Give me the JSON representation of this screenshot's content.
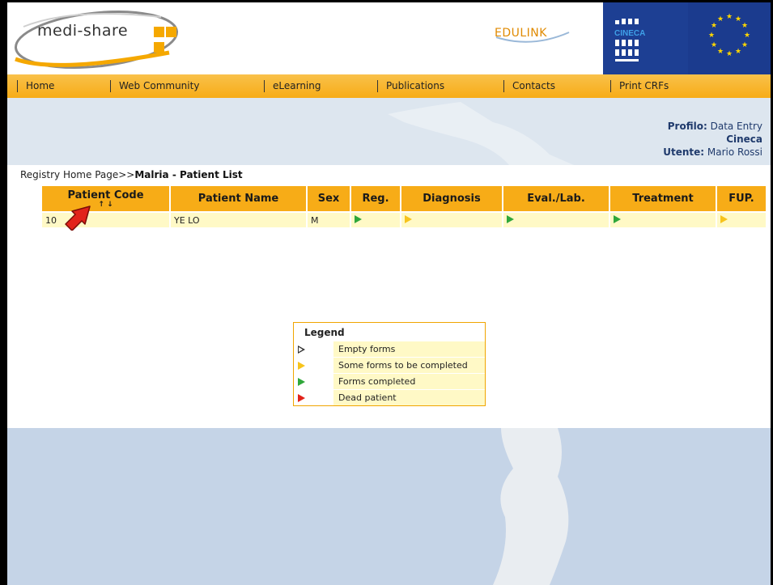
{
  "header": {
    "logo_text": "medi-share",
    "edulink_text": "EDULINK",
    "cineca_text": "CINECA"
  },
  "nav": {
    "items": [
      "Home",
      "Web Community",
      "eLearning",
      "Publications",
      "Contacts",
      "Print CRFs"
    ]
  },
  "profile": {
    "profilo_label": "Profilo:",
    "profilo_value": "Data Entry",
    "org": "Cineca",
    "utente_label": "Utente:",
    "utente_value": "Mario Rossi"
  },
  "breadcrumb": {
    "home": "Registry Home Page>>",
    "current": "Malria - Patient List"
  },
  "table": {
    "headers": [
      "Patient Code",
      "Patient Name",
      "Sex",
      "Reg.",
      "Diagnosis",
      "Eval./Lab.",
      "Treatment",
      "FUP."
    ],
    "sort_arrows": "↑ ↓",
    "rows": [
      {
        "code": "10",
        "name": "YE LO",
        "sex": "M",
        "reg": "green",
        "diagnosis": "yellow",
        "eval": "green",
        "treatment": "green",
        "fup": "yellow"
      }
    ]
  },
  "legend": {
    "title": "Legend",
    "items": [
      {
        "icon": "empty-triangle-icon",
        "label": "Empty forms"
      },
      {
        "icon": "yellow-triangle-icon",
        "label": "Some forms to be completed"
      },
      {
        "icon": "green-triangle-icon",
        "label": "Forms completed"
      },
      {
        "icon": "red-triangle-icon",
        "label": "Dead patient"
      }
    ]
  },
  "colors": {
    "nav": "#f7ac17",
    "row": "#fff9c6",
    "green": "#2fa73a",
    "yellow": "#f7c41c",
    "red": "#e2231a"
  }
}
